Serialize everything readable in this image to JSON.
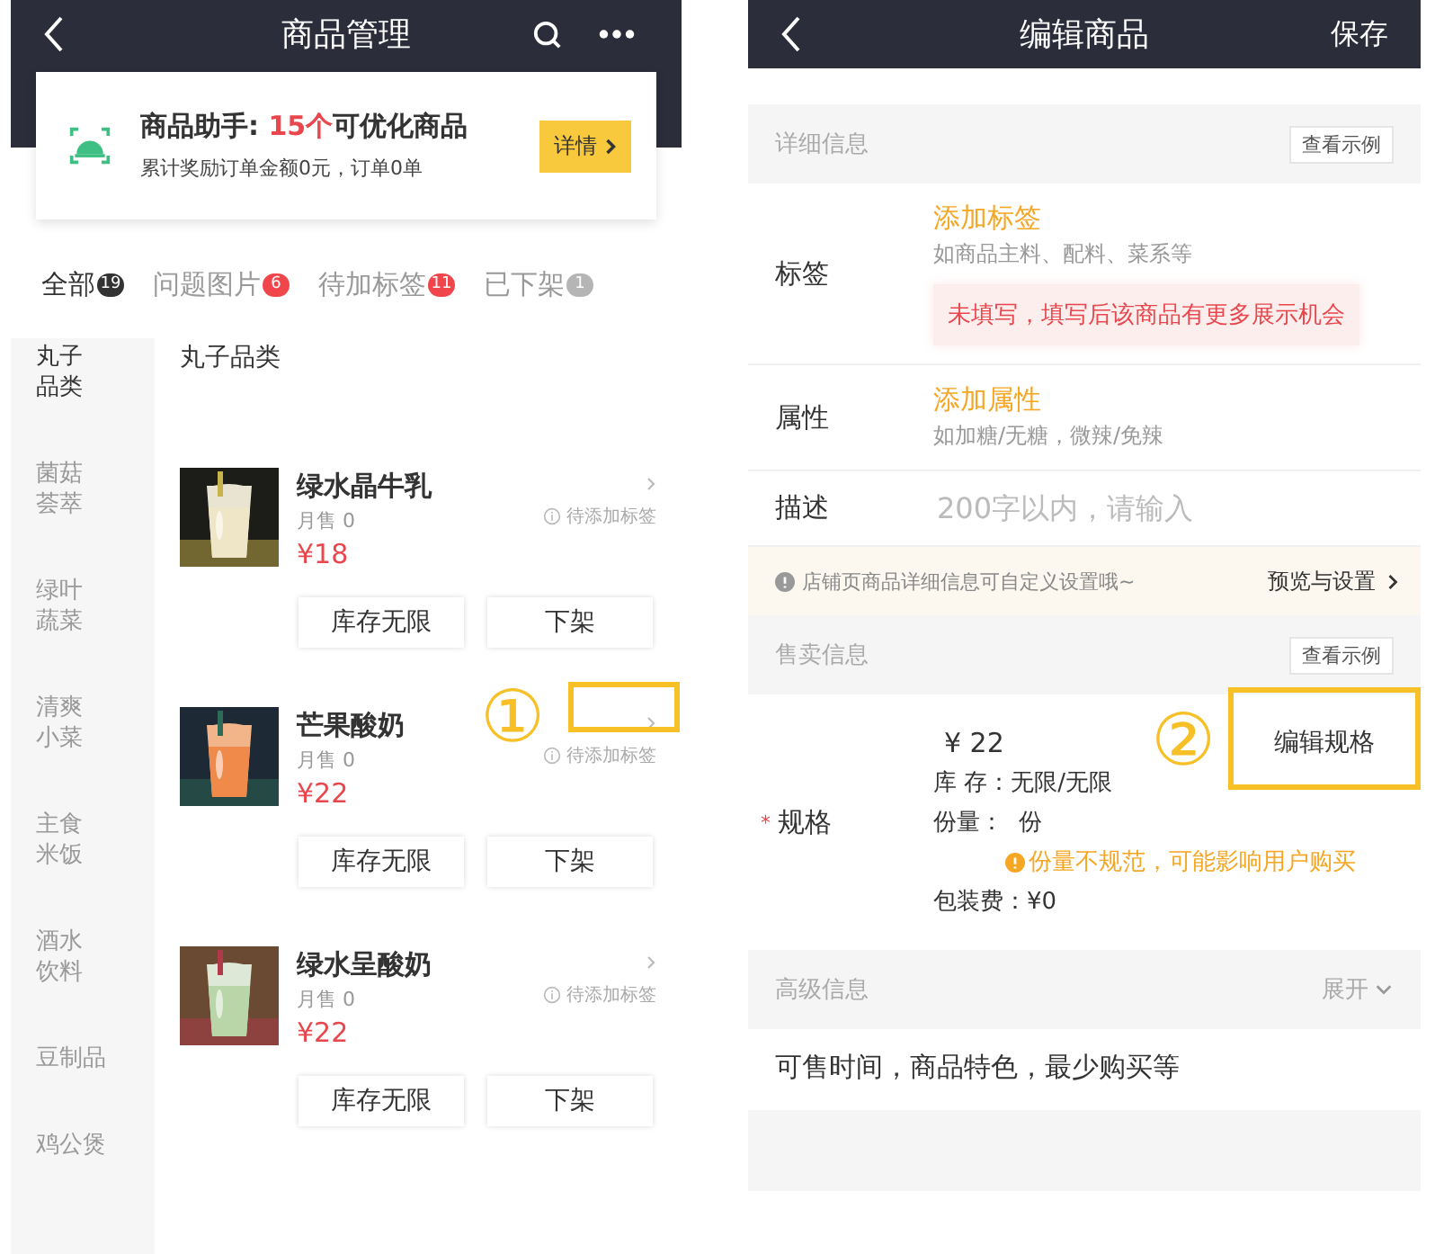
{
  "left": {
    "header": {
      "title": "商品管理"
    },
    "assistant": {
      "title_before": "商品助手: ",
      "title_highlight": "15个",
      "title_after": "可优化商品",
      "subtitle": "累计奖励订单金额0元，订单0单",
      "button": "详情"
    },
    "tabs": [
      {
        "label": "全部",
        "count": "19",
        "selected": true,
        "color": "#333333"
      },
      {
        "label": "问题图片",
        "count": "6",
        "selected": false,
        "color": "#f0464b"
      },
      {
        "label": "待加标签",
        "count": "11",
        "selected": false,
        "color": "#f0464b"
      },
      {
        "label": "已下架",
        "count": "1",
        "selected": false,
        "color": "#b5b5b5"
      }
    ],
    "categories": [
      {
        "name": "丸子品类",
        "selected": true
      },
      {
        "name": "菌菇荟萃",
        "selected": false
      },
      {
        "name": "绿叶蔬菜",
        "selected": false
      },
      {
        "name": "清爽小菜",
        "selected": false
      },
      {
        "name": "主食米饭",
        "selected": false
      },
      {
        "name": "酒水饮料",
        "selected": false
      },
      {
        "name": "豆制品",
        "selected": false
      },
      {
        "name": "鸡公煲",
        "selected": false
      }
    ],
    "category_title": "丸子品类",
    "products": [
      {
        "name": "绿水晶牛乳",
        "sales": "月售 0",
        "price": "¥18",
        "tag": "待添加标签",
        "stock_button": "库存无限",
        "shelf_button": "下架",
        "highlighted": false
      },
      {
        "name": "芒果酸奶",
        "sales": "月售 0",
        "price": "¥22",
        "tag": "待添加标签",
        "stock_button": "库存无限",
        "shelf_button": "下架",
        "highlighted": true
      },
      {
        "name": "绿水呈酸奶",
        "sales": "月售 0",
        "price": "¥22",
        "tag": "待添加标签",
        "stock_button": "库存无限",
        "shelf_button": "下架",
        "highlighted": false
      }
    ],
    "annotation": {
      "number": "①"
    }
  },
  "right": {
    "header": {
      "title": "编辑商品",
      "action": "保存"
    },
    "detail_section": {
      "title": "详细信息",
      "button": "查看示例"
    },
    "fields": [
      {
        "kind": "link",
        "label": "标签",
        "link": "添加标签",
        "hint": "如商品主料、配料、菜系等",
        "warning": "未填写，填写后该商品有更多展示机会"
      },
      {
        "kind": "link",
        "label": "属性",
        "link": "添加属性",
        "hint": "如加糖/无糖，微辣/免辣"
      },
      {
        "kind": "input",
        "label": "描述",
        "placeholder": "200字以内，请输入"
      }
    ],
    "notice": {
      "text": "店铺页商品详细信息可自定义设置哦~",
      "link": "预览与设置"
    },
    "sale_section": {
      "title": "售卖信息",
      "button": "查看示例"
    },
    "spec": {
      "label": "规格",
      "required_mark": "*",
      "price": "¥ 22",
      "stock": "库 存：无限/无限",
      "portion": "份量：  份",
      "warning": "份量不规范，可能影响用户购买",
      "packing": "包装费：¥0",
      "button": "编辑规格",
      "annotation": "②"
    },
    "advanced": {
      "title": "高级信息",
      "toggle": "展开",
      "expanded": false,
      "summary": "可售时间，商品特色，最少购买等"
    }
  }
}
